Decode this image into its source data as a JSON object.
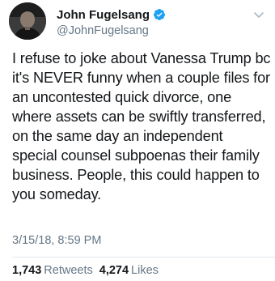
{
  "author": {
    "display_name": "John Fugelsang",
    "handle": "@JohnFugelsang",
    "verified": true,
    "verified_color": "#1da1f2"
  },
  "tweet": {
    "lines": [
      "I refuse to joke about Vanessa Trump bc",
      "it's NEVER funny when a couple files for",
      "an uncontested quick divorce, one",
      "where assets can be swiftly transferred,",
      "on the same day an independent",
      "special counsel subpoenas their family",
      "business.  People, this could happen to",
      "you someday."
    ],
    "timestamp": "3/15/18, 8:59 PM"
  },
  "stats": {
    "retweets_count": "1,743",
    "retweets_label": "Retweets",
    "likes_count": "4,274",
    "likes_label": "Likes"
  },
  "icons": {
    "verified": "verified-badge-icon",
    "menu": "chevron-down-icon"
  },
  "colors": {
    "text_primary": "#14171a",
    "text_secondary": "#657786",
    "divider": "#e1e8ed"
  }
}
